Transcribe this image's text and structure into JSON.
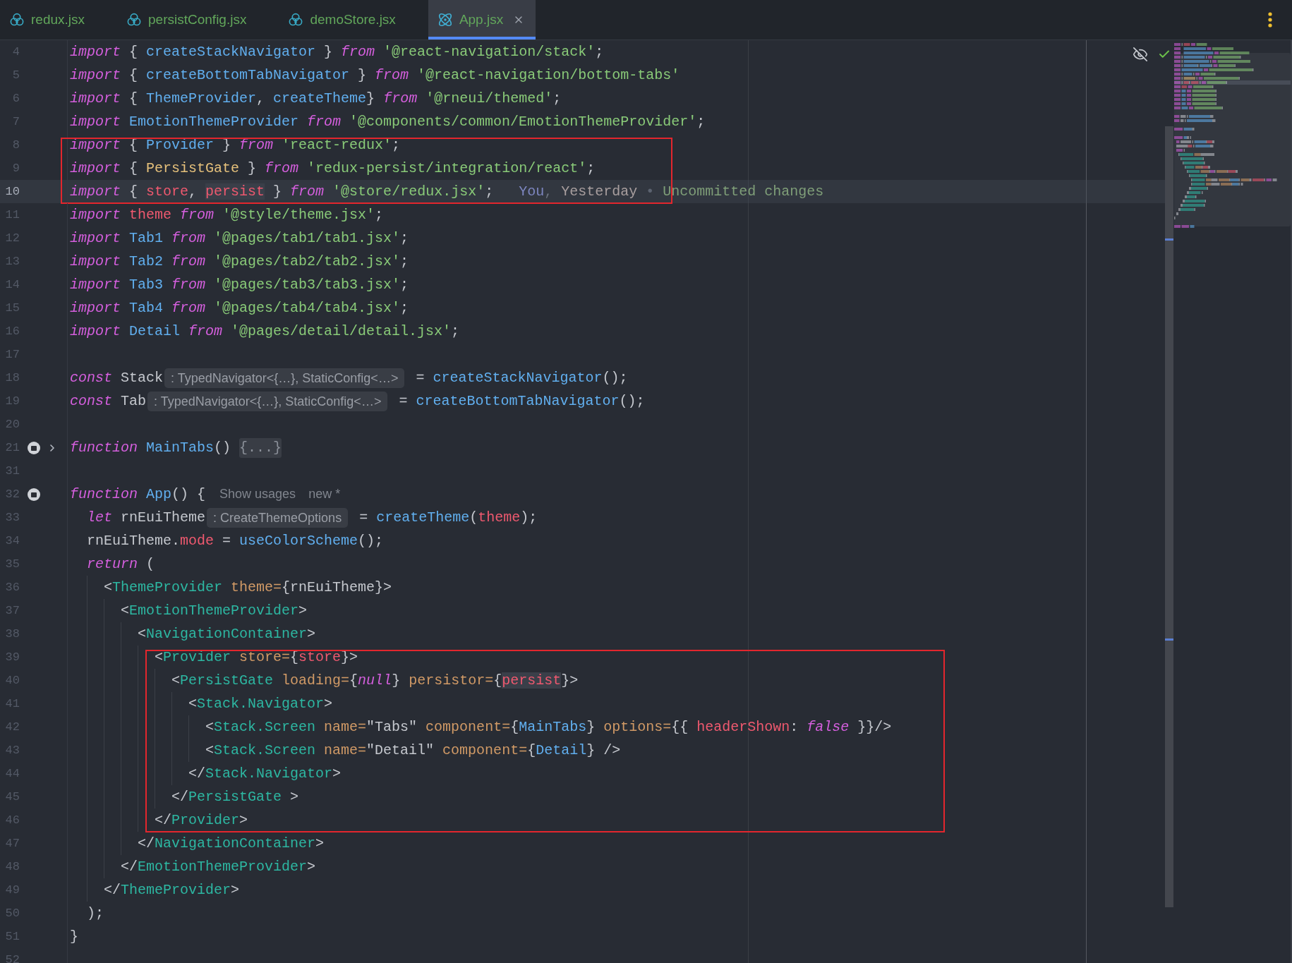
{
  "tabs": [
    {
      "label": "redux.jsx",
      "kind": "store",
      "selected": false
    },
    {
      "label": "persistConfig.jsx",
      "kind": "store",
      "selected": false
    },
    {
      "label": "demoStore.jsx",
      "kind": "store",
      "selected": false
    },
    {
      "label": "App.jsx",
      "kind": "component",
      "selected": true
    }
  ],
  "editor": {
    "blocks": [
      {
        "framed": false,
        "lines": [
          {
            "number": "4",
            "selected": false,
            "segments": [
              {
                "kind": "code",
                "tokens": [
                  {
                    "kind": "keyword",
                    "text": "import"
                  },
                  {
                    "kind": "plain",
                    "text": " { "
                  },
                  {
                    "kind": "function",
                    "text": "createStackNavigator"
                  },
                  {
                    "kind": "plain",
                    "text": " } "
                  },
                  {
                    "kind": "keyword",
                    "text": "from"
                  },
                  {
                    "kind": "string",
                    "text": " '@react-navigation/stack'"
                  },
                  {
                    "kind": "plain",
                    "text": ";"
                  }
                ]
              }
            ]
          },
          {
            "number": "5",
            "selected": false,
            "segments": [
              {
                "kind": "code",
                "tokens": [
                  {
                    "kind": "keyword",
                    "text": "import"
                  },
                  {
                    "kind": "plain",
                    "text": " { "
                  },
                  {
                    "kind": "function",
                    "text": "createBottomTabNavigator"
                  },
                  {
                    "kind": "plain",
                    "text": " } "
                  },
                  {
                    "kind": "keyword",
                    "text": "from"
                  },
                  {
                    "kind": "string",
                    "text": " '@react-navigation/bottom-tabs'"
                  }
                ]
              }
            ]
          },
          {
            "number": "6",
            "selected": false,
            "segments": [
              {
                "kind": "code",
                "tokens": [
                  {
                    "kind": "keyword",
                    "text": "import"
                  },
                  {
                    "kind": "plain",
                    "text": " { "
                  },
                  {
                    "kind": "function",
                    "text": "ThemeProvider"
                  },
                  {
                    "kind": "plain",
                    "text": ", "
                  },
                  {
                    "kind": "function",
                    "text": "createTheme"
                  },
                  {
                    "kind": "plain",
                    "text": "} "
                  },
                  {
                    "kind": "keyword",
                    "text": "from"
                  },
                  {
                    "kind": "string",
                    "text": " '@rneui/themed'"
                  },
                  {
                    "kind": "plain",
                    "text": ";"
                  }
                ]
              }
            ]
          },
          {
            "number": "7",
            "selected": false,
            "segments": [
              {
                "kind": "code",
                "tokens": [
                  {
                    "kind": "keyword",
                    "text": "import"
                  },
                  {
                    "kind": "function",
                    "text": " EmotionThemeProvider "
                  },
                  {
                    "kind": "keyword",
                    "text": "from"
                  },
                  {
                    "kind": "string",
                    "text": " '@components/common/EmotionThemeProvider'"
                  },
                  {
                    "kind": "plain",
                    "text": ";"
                  }
                ]
              }
            ]
          }
        ]
      },
      {
        "framed": true,
        "lines": [
          {
            "number": "8",
            "selected": false,
            "segments": [
              {
                "kind": "code",
                "tokens": [
                  {
                    "kind": "keyword",
                    "text": "import"
                  },
                  {
                    "kind": "plain",
                    "text": " { "
                  },
                  {
                    "kind": "function",
                    "text": "Provider"
                  },
                  {
                    "kind": "plain",
                    "text": " } "
                  },
                  {
                    "kind": "keyword",
                    "text": "from"
                  },
                  {
                    "kind": "string",
                    "text": " 'react-redux'"
                  },
                  {
                    "kind": "plain",
                    "text": ";"
                  }
                ]
              }
            ]
          },
          {
            "number": "9",
            "selected": false,
            "segments": [
              {
                "kind": "code",
                "tokens": [
                  {
                    "kind": "keyword",
                    "text": "import"
                  },
                  {
                    "kind": "plain",
                    "text": " { "
                  },
                  {
                    "kind": "class",
                    "text": "PersistGate"
                  },
                  {
                    "kind": "plain",
                    "text": " } "
                  },
                  {
                    "kind": "keyword",
                    "text": "from"
                  },
                  {
                    "kind": "string",
                    "text": " 'redux-persist/integration/react'"
                  },
                  {
                    "kind": "plain",
                    "text": ";"
                  }
                ]
              }
            ]
          },
          {
            "number": "10",
            "selected": true,
            "segments": [
              {
                "kind": "code",
                "tokens": [
                  {
                    "kind": "keyword",
                    "text": "import"
                  },
                  {
                    "kind": "plain",
                    "text": " { "
                  },
                  {
                    "kind": "variable",
                    "text": "store"
                  },
                  {
                    "kind": "plain",
                    "text": ", "
                  },
                  {
                    "kind": "usage",
                    "text": "persist"
                  },
                  {
                    "kind": "plain",
                    "text": " } "
                  },
                  {
                    "kind": "keyword",
                    "text": "from"
                  },
                  {
                    "kind": "string",
                    "text": " '@store/redux.jsx'"
                  },
                  {
                    "kind": "plain",
                    "text": ";"
                  }
                ]
              },
              {
                "kind": "blame",
                "tokens": [
                  {
                    "kind": "author",
                    "text": "You"
                  },
                  {
                    "kind": "plain",
                    "text": ", "
                  },
                  {
                    "kind": "date",
                    "text": "Yesterday"
                  },
                  {
                    "kind": "separator",
                    "text": " • "
                  },
                  {
                    "kind": "message",
                    "text": "Uncommitted changes"
                  }
                ]
              }
            ]
          }
        ]
      },
      {
        "framed": false,
        "lines": [
          {
            "number": "11",
            "selected": false,
            "segments": [
              {
                "kind": "code",
                "tokens": [
                  {
                    "kind": "keyword",
                    "text": "import"
                  },
                  {
                    "kind": "variable",
                    "text": " theme "
                  },
                  {
                    "kind": "keyword",
                    "text": "from"
                  },
                  {
                    "kind": "string",
                    "text": " '@style/theme.jsx'"
                  },
                  {
                    "kind": "plain",
                    "text": ";"
                  }
                ]
              }
            ]
          },
          {
            "number": "12",
            "selected": false,
            "segments": [
              {
                "kind": "code",
                "tokens": [
                  {
                    "kind": "keyword",
                    "text": "import"
                  },
                  {
                    "kind": "function",
                    "text": " Tab1 "
                  },
                  {
                    "kind": "keyword",
                    "text": "from"
                  },
                  {
                    "kind": "string",
                    "text": " '@pages/tab1/tab1.jsx'"
                  },
                  {
                    "kind": "plain",
                    "text": ";"
                  }
                ]
              }
            ]
          },
          {
            "number": "13",
            "selected": false,
            "segments": [
              {
                "kind": "code",
                "tokens": [
                  {
                    "kind": "keyword",
                    "text": "import"
                  },
                  {
                    "kind": "function",
                    "text": " Tab2 "
                  },
                  {
                    "kind": "keyword",
                    "text": "from"
                  },
                  {
                    "kind": "string",
                    "text": " '@pages/tab2/tab2.jsx'"
                  },
                  {
                    "kind": "plain",
                    "text": ";"
                  }
                ]
              }
            ]
          },
          {
            "number": "14",
            "selected": false,
            "segments": [
              {
                "kind": "code",
                "tokens": [
                  {
                    "kind": "keyword",
                    "text": "import"
                  },
                  {
                    "kind": "function",
                    "text": " Tab3 "
                  },
                  {
                    "kind": "keyword",
                    "text": "from"
                  },
                  {
                    "kind": "string",
                    "text": " '@pages/tab3/tab3.jsx'"
                  },
                  {
                    "kind": "plain",
                    "text": ";"
                  }
                ]
              }
            ]
          },
          {
            "number": "15",
            "selected": false,
            "segments": [
              {
                "kind": "code",
                "tokens": [
                  {
                    "kind": "keyword",
                    "text": "import"
                  },
                  {
                    "kind": "function",
                    "text": " Tab4 "
                  },
                  {
                    "kind": "keyword",
                    "text": "from"
                  },
                  {
                    "kind": "string",
                    "text": " '@pages/tab4/tab4.jsx'"
                  },
                  {
                    "kind": "plain",
                    "text": ";"
                  }
                ]
              }
            ]
          },
          {
            "number": "16",
            "selected": false,
            "segments": [
              {
                "kind": "code",
                "tokens": [
                  {
                    "kind": "keyword",
                    "text": "import"
                  },
                  {
                    "kind": "function",
                    "text": " Detail "
                  },
                  {
                    "kind": "keyword",
                    "text": "from"
                  },
                  {
                    "kind": "string",
                    "text": " '@pages/detail/detail.jsx'"
                  },
                  {
                    "kind": "plain",
                    "text": ";"
                  }
                ]
              }
            ]
          },
          {
            "number": "17",
            "selected": false
          },
          {
            "number": "18",
            "selected": false,
            "segments": [
              {
                "kind": "code",
                "tokens": [
                  {
                    "kind": "keyword",
                    "text": "const"
                  },
                  {
                    "kind": "plain",
                    "text": " Stack"
                  }
                ]
              },
              {
                "kind": "hint",
                "text": ": TypedNavigator<{…}, StaticConfig<…>"
              },
              {
                "kind": "code",
                "tokens": [
                  {
                    "kind": "plain",
                    "text": " = "
                  },
                  {
                    "kind": "function",
                    "text": "createStackNavigator"
                  },
                  {
                    "kind": "plain",
                    "text": "();"
                  }
                ]
              }
            ]
          },
          {
            "number": "19",
            "selected": false,
            "segments": [
              {
                "kind": "code",
                "tokens": [
                  {
                    "kind": "keyword",
                    "text": "const"
                  },
                  {
                    "kind": "plain",
                    "text": " Tab"
                  }
                ]
              },
              {
                "kind": "hint",
                "text": ": TypedNavigator<{…}, StaticConfig<…>"
              },
              {
                "kind": "code",
                "tokens": [
                  {
                    "kind": "plain",
                    "text": " = "
                  },
                  {
                    "kind": "function",
                    "text": "createBottomTabNavigator"
                  },
                  {
                    "kind": "plain",
                    "text": "();"
                  }
                ]
              }
            ]
          },
          {
            "number": "20",
            "selected": false
          },
          {
            "number": "21",
            "selected": false,
            "gutter": [
              {
                "kind": "marker"
              },
              {
                "kind": "expand"
              }
            ],
            "segments": [
              {
                "kind": "code",
                "tokens": [
                  {
                    "kind": "keyword",
                    "text": "function"
                  },
                  {
                    "kind": "function",
                    "text": " MainTabs"
                  },
                  {
                    "kind": "plain",
                    "text": "() "
                  }
                ]
              },
              {
                "kind": "fold",
                "text": "{...}"
              }
            ]
          },
          {
            "number": "31",
            "selected": false
          },
          {
            "number": "32",
            "selected": false,
            "gutter": [
              {
                "kind": "marker"
              }
            ],
            "segments": [
              {
                "kind": "code",
                "tokens": [
                  {
                    "kind": "keyword",
                    "text": "function"
                  },
                  {
                    "kind": "function",
                    "text": " App"
                  },
                  {
                    "kind": "plain",
                    "text": "() {"
                  }
                ]
              },
              {
                "kind": "link",
                "text": "Show usages"
              },
              {
                "kind": "note",
                "text": "new *"
              }
            ]
          },
          {
            "number": "33",
            "selected": false,
            "segments": [
              {
                "kind": "code",
                "tokens": [
                  {
                    "kind": "keyword",
                    "text": "  let"
                  },
                  {
                    "kind": "plain",
                    "text": " rnEuiTheme"
                  }
                ]
              },
              {
                "kind": "hint",
                "text": ": CreateThemeOptions"
              },
              {
                "kind": "code",
                "tokens": [
                  {
                    "kind": "plain",
                    "text": " = "
                  },
                  {
                    "kind": "function",
                    "text": "createTheme"
                  },
                  {
                    "kind": "plain",
                    "text": "("
                  },
                  {
                    "kind": "variable",
                    "text": "theme"
                  },
                  {
                    "kind": "plain",
                    "text": ");"
                  }
                ]
              }
            ]
          },
          {
            "number": "34",
            "selected": false,
            "segments": [
              {
                "kind": "code",
                "tokens": [
                  {
                    "kind": "plain",
                    "text": "  rnEuiTheme."
                  },
                  {
                    "kind": "variable",
                    "text": "mode"
                  },
                  {
                    "kind": "plain",
                    "text": " = "
                  },
                  {
                    "kind": "function",
                    "text": "useColorScheme"
                  },
                  {
                    "kind": "plain",
                    "text": "();"
                  }
                ]
              }
            ]
          },
          {
            "number": "35",
            "selected": false,
            "segments": [
              {
                "kind": "code",
                "tokens": [
                  {
                    "kind": "keyword",
                    "text": "  return"
                  },
                  {
                    "kind": "plain",
                    "text": " ("
                  }
                ]
              }
            ]
          },
          {
            "number": "36",
            "selected": false,
            "segments": [
              {
                "kind": "code",
                "tokens": [
                  {
                    "kind": "plain",
                    "text": "    <"
                  },
                  {
                    "kind": "tag",
                    "text": "ThemeProvider"
                  },
                  {
                    "kind": "attribute",
                    "text": " theme="
                  },
                  {
                    "kind": "plain",
                    "text": "{rnEuiTheme}>"
                  }
                ]
              }
            ]
          },
          {
            "number": "37",
            "selected": false,
            "segments": [
              {
                "kind": "code",
                "tokens": [
                  {
                    "kind": "plain",
                    "text": "      <"
                  },
                  {
                    "kind": "tag",
                    "text": "EmotionThemeProvider"
                  },
                  {
                    "kind": "plain",
                    "text": ">"
                  }
                ]
              }
            ]
          },
          {
            "number": "38",
            "selected": false,
            "segments": [
              {
                "kind": "code",
                "tokens": [
                  {
                    "kind": "plain",
                    "text": "        <"
                  },
                  {
                    "kind": "tag",
                    "text": "NavigationContainer"
                  },
                  {
                    "kind": "plain",
                    "text": ">"
                  }
                ]
              }
            ]
          }
        ]
      },
      {
        "framed": true,
        "lines": [
          {
            "number": "39",
            "selected": false,
            "segments": [
              {
                "kind": "code",
                "tokens": [
                  {
                    "kind": "plain",
                    "text": "          <"
                  },
                  {
                    "kind": "tag",
                    "text": "Provider"
                  },
                  {
                    "kind": "attribute",
                    "text": " store="
                  },
                  {
                    "kind": "plain",
                    "text": "{"
                  },
                  {
                    "kind": "variable",
                    "text": "store"
                  },
                  {
                    "kind": "plain",
                    "text": "}>"
                  }
                ]
              }
            ]
          },
          {
            "number": "40",
            "selected": false,
            "segments": [
              {
                "kind": "code",
                "tokens": [
                  {
                    "kind": "plain",
                    "text": "            <"
                  },
                  {
                    "kind": "tag",
                    "text": "PersistGate"
                  },
                  {
                    "kind": "attribute",
                    "text": " loading="
                  },
                  {
                    "kind": "plain",
                    "text": "{"
                  },
                  {
                    "kind": "keyword",
                    "text": "null"
                  },
                  {
                    "kind": "plain",
                    "text": "}"
                  },
                  {
                    "kind": "attribute",
                    "text": " persistor="
                  },
                  {
                    "kind": "plain",
                    "text": "{"
                  },
                  {
                    "kind": "usage",
                    "text": "persist"
                  },
                  {
                    "kind": "plain",
                    "text": "}>"
                  }
                ]
              }
            ]
          },
          {
            "number": "41",
            "selected": false,
            "segments": [
              {
                "kind": "code",
                "tokens": [
                  {
                    "kind": "plain",
                    "text": "              <"
                  },
                  {
                    "kind": "tag",
                    "text": "Stack.Navigator"
                  },
                  {
                    "kind": "plain",
                    "text": ">"
                  }
                ]
              }
            ]
          },
          {
            "number": "42",
            "selected": false,
            "segments": [
              {
                "kind": "code",
                "tokens": [
                  {
                    "kind": "plain",
                    "text": "                <"
                  },
                  {
                    "kind": "tag",
                    "text": "Stack.Screen"
                  },
                  {
                    "kind": "attribute",
                    "text": " name="
                  },
                  {
                    "kind": "plain",
                    "text": "\"Tabs\""
                  },
                  {
                    "kind": "attribute",
                    "text": " component="
                  },
                  {
                    "kind": "plain",
                    "text": "{"
                  },
                  {
                    "kind": "function",
                    "text": "MainTabs"
                  },
                  {
                    "kind": "plain",
                    "text": "}"
                  },
                  {
                    "kind": "attribute",
                    "text": " options="
                  },
                  {
                    "kind": "plain",
                    "text": "{{ "
                  },
                  {
                    "kind": "variable",
                    "text": "headerShown"
                  },
                  {
                    "kind": "plain",
                    "text": ": "
                  },
                  {
                    "kind": "keyword",
                    "text": "false"
                  },
                  {
                    "kind": "plain",
                    "text": " }}/>"
                  }
                ]
              }
            ]
          },
          {
            "number": "43",
            "selected": false,
            "segments": [
              {
                "kind": "code",
                "tokens": [
                  {
                    "kind": "plain",
                    "text": "                <"
                  },
                  {
                    "kind": "tag",
                    "text": "Stack.Screen"
                  },
                  {
                    "kind": "attribute",
                    "text": " name="
                  },
                  {
                    "kind": "plain",
                    "text": "\"Detail\""
                  },
                  {
                    "kind": "attribute",
                    "text": " component="
                  },
                  {
                    "kind": "plain",
                    "text": "{"
                  },
                  {
                    "kind": "function",
                    "text": "Detail"
                  },
                  {
                    "kind": "plain",
                    "text": "} />"
                  }
                ]
              }
            ]
          },
          {
            "number": "44",
            "selected": false,
            "segments": [
              {
                "kind": "code",
                "tokens": [
                  {
                    "kind": "plain",
                    "text": "              </"
                  },
                  {
                    "kind": "tag",
                    "text": "Stack.Navigator"
                  },
                  {
                    "kind": "plain",
                    "text": ">"
                  }
                ]
              }
            ]
          },
          {
            "number": "45",
            "selected": false,
            "segments": [
              {
                "kind": "code",
                "tokens": [
                  {
                    "kind": "plain",
                    "text": "            </"
                  },
                  {
                    "kind": "tag",
                    "text": "PersistGate"
                  },
                  {
                    "kind": "plain",
                    "text": " >"
                  }
                ]
              }
            ]
          },
          {
            "number": "46",
            "selected": false,
            "segments": [
              {
                "kind": "code",
                "tokens": [
                  {
                    "kind": "plain",
                    "text": "          </"
                  },
                  {
                    "kind": "tag",
                    "text": "Provider"
                  },
                  {
                    "kind": "plain",
                    "text": ">"
                  }
                ]
              }
            ]
          }
        ]
      },
      {
        "framed": false,
        "lines": [
          {
            "number": "47",
            "selected": false,
            "segments": [
              {
                "kind": "code",
                "tokens": [
                  {
                    "kind": "plain",
                    "text": "        </"
                  },
                  {
                    "kind": "tag",
                    "text": "NavigationContainer"
                  },
                  {
                    "kind": "plain",
                    "text": ">"
                  }
                ]
              }
            ]
          },
          {
            "number": "48",
            "selected": false,
            "segments": [
              {
                "kind": "code",
                "tokens": [
                  {
                    "kind": "plain",
                    "text": "      </"
                  },
                  {
                    "kind": "tag",
                    "text": "EmotionThemeProvider"
                  },
                  {
                    "kind": "plain",
                    "text": ">"
                  }
                ]
              }
            ]
          },
          {
            "number": "49",
            "selected": false,
            "segments": [
              {
                "kind": "code",
                "tokens": [
                  {
                    "kind": "plain",
                    "text": "    </"
                  },
                  {
                    "kind": "tag",
                    "text": "ThemeProvider"
                  },
                  {
                    "kind": "plain",
                    "text": ">"
                  }
                ]
              }
            ]
          },
          {
            "number": "50",
            "selected": false,
            "segments": [
              {
                "kind": "code",
                "tokens": [
                  {
                    "kind": "plain",
                    "text": "  );"
                  }
                ]
              }
            ]
          },
          {
            "number": "51",
            "selected": false,
            "segments": [
              {
                "kind": "code",
                "tokens": [
                  {
                    "kind": "plain",
                    "text": "}"
                  }
                ]
              }
            ]
          },
          {
            "number": "52",
            "selected": false
          }
        ]
      }
    ]
  }
}
